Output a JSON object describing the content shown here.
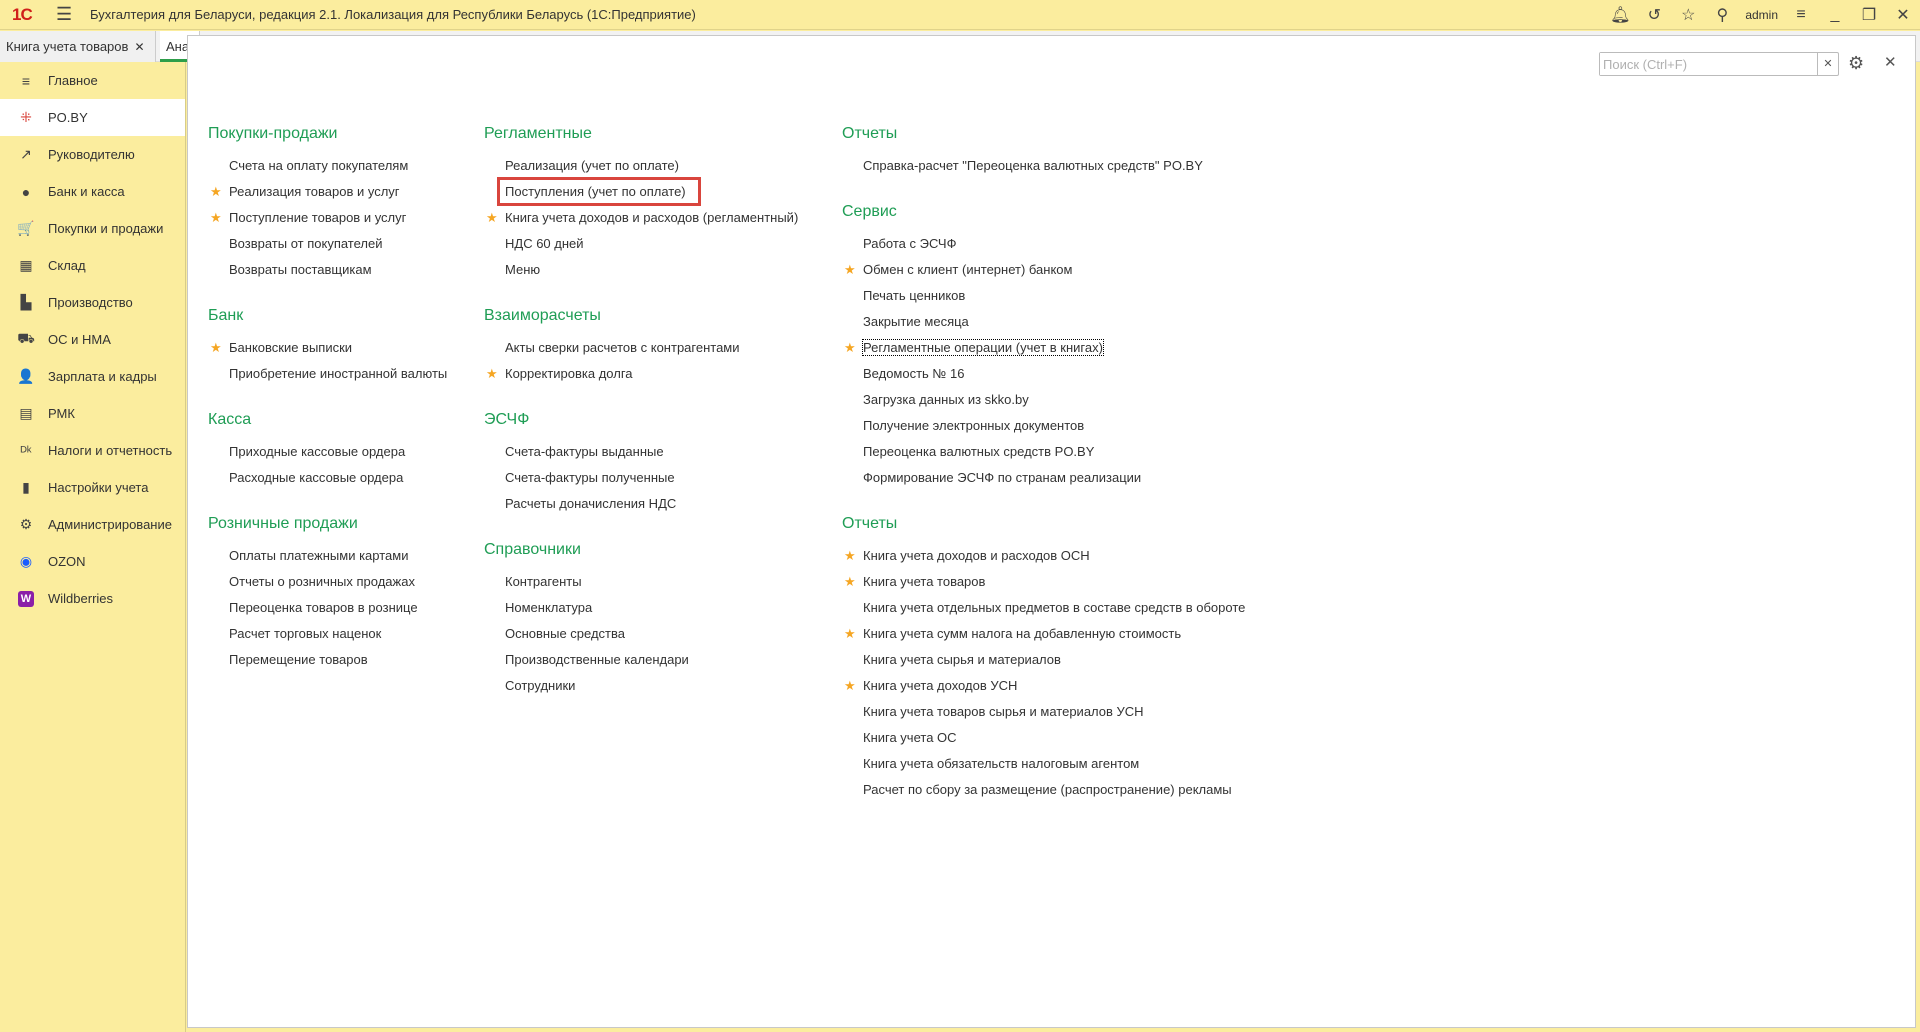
{
  "titlebar": {
    "logo": "1С",
    "title": "Бухгалтерия для Беларуси, редакция 2.1. Локализация для Республики Беларусь   (1С:Предприятие)",
    "user": "admin"
  },
  "tabs": [
    {
      "label": "Книга учета товаров"
    },
    {
      "label": "Ана"
    }
  ],
  "sidebar": [
    {
      "label": "Главное",
      "icon": "≡"
    },
    {
      "label": "PO.BY",
      "icon": "⁜",
      "active": true
    },
    {
      "label": "Руководителю",
      "icon": "↗"
    },
    {
      "label": "Банк и касса",
      "icon": "●"
    },
    {
      "label": "Покупки и продажи",
      "icon": "🛒"
    },
    {
      "label": "Склад",
      "icon": "▦"
    },
    {
      "label": "Производство",
      "icon": "▙"
    },
    {
      "label": "ОС и НМА",
      "icon": "⛟"
    },
    {
      "label": "Зарплата и кадры",
      "icon": "👤"
    },
    {
      "label": "РМК",
      "icon": "▤"
    },
    {
      "label": "Налоги и отчетность",
      "icon": "ᴰᵏ"
    },
    {
      "label": "Настройки учета",
      "icon": "▮"
    },
    {
      "label": "Администрирование",
      "icon": "⚙"
    },
    {
      "label": "OZON",
      "icon": "◉"
    },
    {
      "label": "Wildberries",
      "icon": "W"
    }
  ],
  "search": {
    "placeholder": "Поиск (Ctrl+F)",
    "value": ""
  },
  "columns": [
    [
      {
        "title": "Покупки-продажи",
        "items": [
          {
            "t": "Счета на оплату покупателям"
          },
          {
            "t": "Реализация товаров и услуг",
            "star": true
          },
          {
            "t": "Поступление товаров и услуг",
            "star": true
          },
          {
            "t": "Возвраты от покупателей"
          },
          {
            "t": "Возвраты поставщикам"
          }
        ]
      },
      {
        "title": "Банк",
        "items": [
          {
            "t": "Банковские выписки",
            "star": true
          },
          {
            "t": "Приобретение иностранной валюты"
          }
        ]
      },
      {
        "title": "Касса",
        "items": [
          {
            "t": "Приходные кассовые ордера"
          },
          {
            "t": "Расходные кассовые ордера"
          }
        ]
      },
      {
        "title": "Розничные продажи",
        "items": [
          {
            "t": "Оплаты платежными картами"
          },
          {
            "t": "Отчеты о розничных продажах"
          },
          {
            "t": "Переоценка товаров в рознице"
          },
          {
            "t": "Расчет торговых наценок"
          },
          {
            "t": "Перемещение товаров"
          }
        ]
      }
    ],
    [
      {
        "title": "Регламентные",
        "items": [
          {
            "t": "Реализация (учет по оплате)"
          },
          {
            "t": "Поступления (учет по оплате)",
            "highlight": true
          },
          {
            "t": "Книга учета доходов и расходов (регламентный)",
            "star": true
          },
          {
            "t": "НДС 60 дней"
          },
          {
            "t": "Меню"
          }
        ]
      },
      {
        "title": "Взаиморасчеты",
        "items": [
          {
            "t": "Акты сверки расчетов с контрагентами"
          },
          {
            "t": "Корректировка долга",
            "star": true
          }
        ]
      },
      {
        "title": "ЭСЧФ",
        "items": [
          {
            "t": "Счета-фактуры выданные"
          },
          {
            "t": "Счета-фактуры полученные"
          },
          {
            "t": "Расчеты доначисления НДС"
          }
        ]
      },
      {
        "title": "Справочники",
        "items": [
          {
            "t": "Контрагенты"
          },
          {
            "t": "Номенклатура"
          },
          {
            "t": "Основные средства"
          },
          {
            "t": "Производственные календари"
          },
          {
            "t": "Сотрудники"
          }
        ]
      }
    ],
    [
      {
        "title": "Отчеты",
        "items": [
          {
            "t": "Справка-расчет \"Переоценка валютных средств\" PO.BY"
          }
        ]
      },
      {
        "title": "Сервис",
        "items": [
          {
            "t": "Работа с ЭСЧФ"
          },
          {
            "t": "Обмен с клиент (интернет) банком",
            "star": true
          },
          {
            "t": "Печать ценников"
          },
          {
            "t": "Закрытие месяца"
          },
          {
            "t": "Регламентные операции (учет в книгах)",
            "star": true,
            "focus": true
          },
          {
            "t": "Ведомость № 16"
          },
          {
            "t": "Загрузка данных из skko.by"
          },
          {
            "t": "Получение электронных документов"
          },
          {
            "t": "Переоценка валютных средств PO.BY"
          },
          {
            "t": "Формирование ЭСЧФ по странам реализации"
          }
        ]
      },
      {
        "title": "Отчеты",
        "items": [
          {
            "t": "Книга учета доходов и расходов ОСН",
            "star": true
          },
          {
            "t": "Книга учета товаров",
            "star": true
          },
          {
            "t": "Книга учета отдельных предметов в составе средств в обороте"
          },
          {
            "t": "Книга учета сумм налога на добавленную стоимость",
            "star": true
          },
          {
            "t": "Книга учета сырья и материалов"
          },
          {
            "t": "Книга учета доходов УСН",
            "star": true
          },
          {
            "t": "Книга учета товаров сырья и материалов УСН"
          },
          {
            "t": "Книга учета ОС"
          },
          {
            "t": "Книга учета обязательств налоговым агентом"
          },
          {
            "t": "Расчет по сбору за размещение (распространение) рекламы"
          }
        ]
      }
    ]
  ]
}
